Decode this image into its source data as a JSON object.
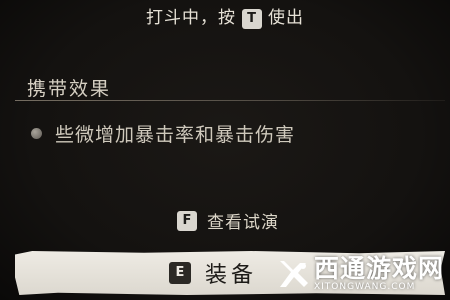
{
  "top_hint": {
    "prefix": "打斗中，按",
    "key": "T",
    "suffix": "使出"
  },
  "section": {
    "title": "携带效果"
  },
  "effect": {
    "bullet_icon": "round-bullet-icon",
    "text": "些微增加暴击率和暴击伤害"
  },
  "preview": {
    "key": "F",
    "label": "查看试演"
  },
  "equip": {
    "key": "E",
    "label": "装备"
  },
  "watermark": {
    "logo_icon": "xitong-logo-icon",
    "cn": "西通游戏网",
    "en": "XITONGWANG.COM"
  },
  "colors": {
    "background": "#141210",
    "text": "#dcd6c8",
    "key_bg": "#d9d6cf",
    "button_bg": "#eeebe4"
  }
}
